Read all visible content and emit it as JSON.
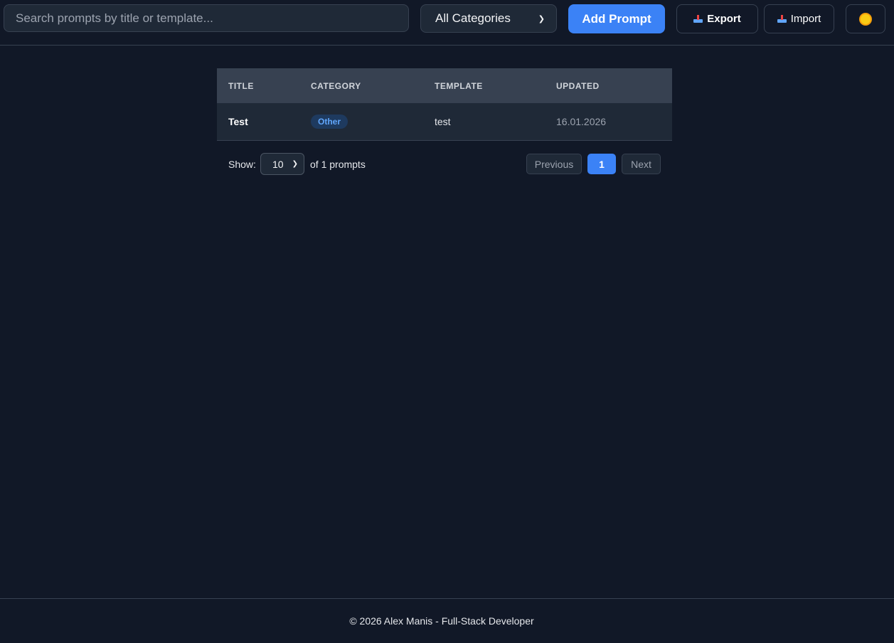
{
  "header": {
    "search_placeholder": "Search prompts by title or template...",
    "search_value": "",
    "category_selected": "All Categories",
    "add_label": "Add Prompt",
    "export_label": "Export",
    "import_label": "Import",
    "icons": {
      "export": "tray-arrow-icon",
      "import": "tray-arrow-icon",
      "theme": "sun-icon"
    }
  },
  "table": {
    "columns": [
      "TITLE",
      "CATEGORY",
      "TEMPLATE",
      "UPDATED"
    ],
    "rows": [
      {
        "title": "Test",
        "category": "Other",
        "template": "test",
        "updated": "16.01.2026"
      }
    ]
  },
  "pagination": {
    "show_label": "Show:",
    "page_size": "10",
    "count_label": "of 1 prompts",
    "previous_label": "Previous",
    "current_page": "1",
    "next_label": "Next"
  },
  "footer": {
    "text": "© 2026 Alex Manis - Full-Stack Developer"
  },
  "colors": {
    "background": "#111827",
    "accent": "#3b82f6",
    "badge_text": "#60a5fa"
  }
}
